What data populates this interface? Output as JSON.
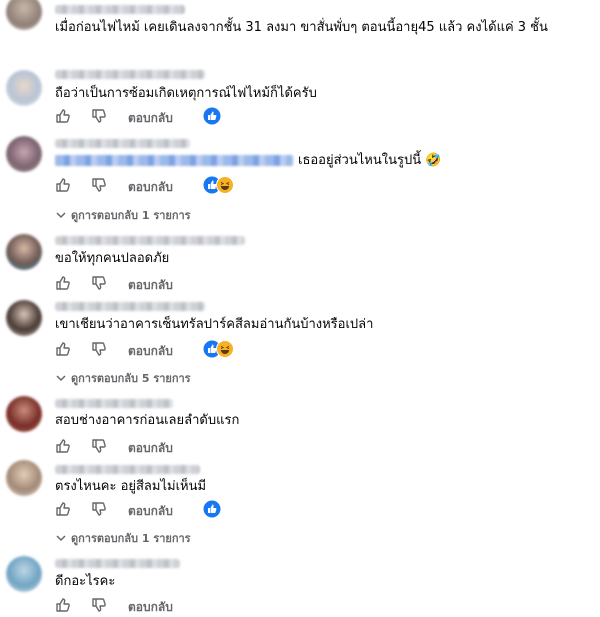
{
  "ui": {
    "reply_label": "ตอบกลับ",
    "colors": {
      "reply_text": "#65676b",
      "like_blue": "#1877f2",
      "haha_yellow": "#f7b125"
    }
  },
  "comments": [
    {
      "text": "เมื่อก่อนไฟไหม้ เคยเดินลงจากชั้น 31 ลงมา ขาสั่นพั่บๆ ตอนนี้อายุ45 แล้ว คงได้แค่ 3 ชั้น",
      "reactions": []
    },
    {
      "text": "ถือว่าเป็นการซ้อมเกิดเหตุการณ์ไฟไหม้ก็ได้ครับ",
      "reactions": [
        "like"
      ]
    },
    {
      "text": "เธออยู่ส่วนไหนในรูปนี้ 🤣",
      "reactions": [
        "like",
        "haha"
      ],
      "replies": "ดูการตอบกลับ 1 รายการ"
    },
    {
      "text": "ขอให้ทุกคนปลอดภัย",
      "reactions": []
    },
    {
      "text": "เขาเชียนว่าอาคารเซ็นทรัลปาร์คสีลมอ่านกันบ้างหรือเปล่า",
      "reactions": [
        "like",
        "haha"
      ],
      "replies": "ดูการตอบกลับ 5 รายการ"
    },
    {
      "text": "สอบช่างอาคารก่อนเลยลำดับแรก",
      "reactions": []
    },
    {
      "text": "ตรงไหนคะ อยู่สีลมไม่เห็นมี",
      "reactions": [
        "like"
      ],
      "replies": "ดูการตอบกลับ 1 รายการ"
    },
    {
      "text": "ดีกอะไรคะ",
      "reactions": []
    }
  ]
}
